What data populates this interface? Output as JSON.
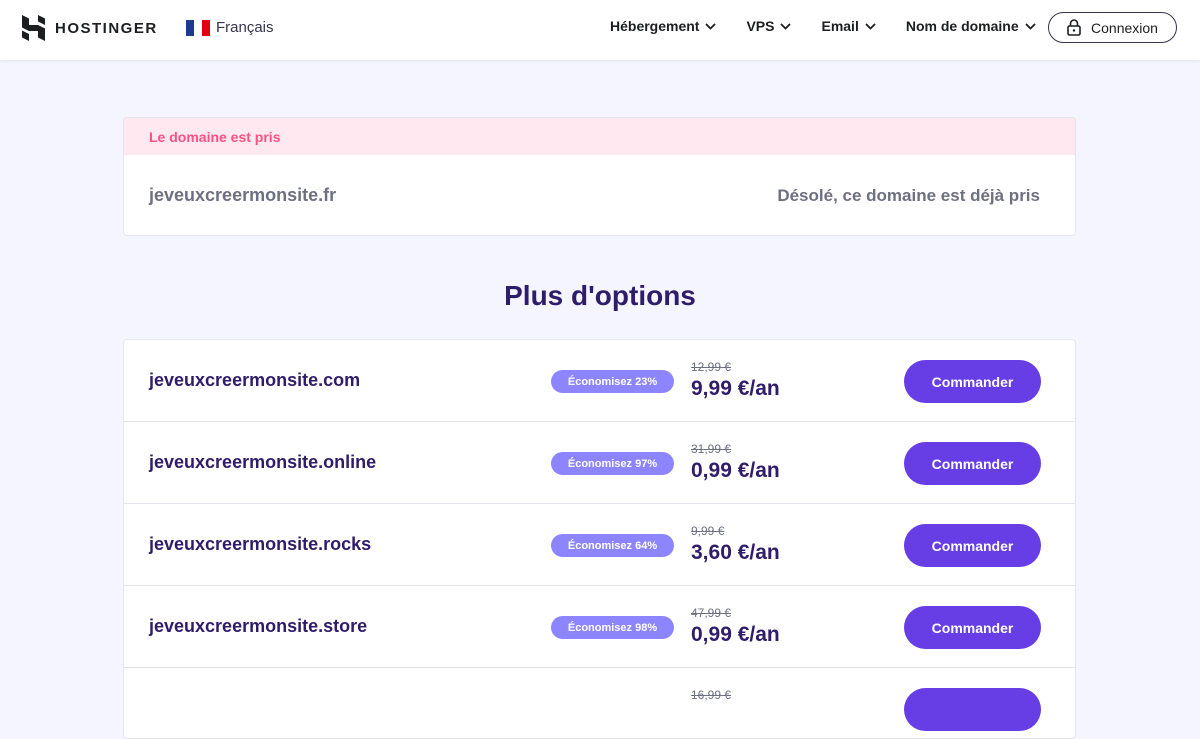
{
  "header": {
    "brand": "HOSTINGER",
    "language": "Français",
    "nav": [
      {
        "label": "Hébergement"
      },
      {
        "label": "VPS"
      },
      {
        "label": "Email"
      },
      {
        "label": "Nom de domaine"
      }
    ],
    "login_label": "Connexion"
  },
  "taken": {
    "title": "Le domaine est pris",
    "domain": "jeveuxcreermonsite.fr",
    "message": "Désolé, ce domaine est déjà pris"
  },
  "options_title": "Plus d'options",
  "options": [
    {
      "domain": "jeveuxcreermonsite.com",
      "badge": "Économisez 23%",
      "old_price": "12,99 €",
      "price": "9,99 €/an",
      "button": "Commander"
    },
    {
      "domain": "jeveuxcreermonsite.online",
      "badge": "Économisez 97%",
      "old_price": "31,99 €",
      "price": "0,99 €/an",
      "button": "Commander"
    },
    {
      "domain": "jeveuxcreermonsite.rocks",
      "badge": "Économisez 64%",
      "old_price": "9,99 €",
      "price": "3,60 €/an",
      "button": "Commander"
    },
    {
      "domain": "jeveuxcreermonsite.store",
      "badge": "Économisez 98%",
      "old_price": "47,99 €",
      "price": "0,99 €/an",
      "button": "Commander"
    },
    {
      "domain": "",
      "badge": "",
      "old_price": "16,99 €",
      "price": "",
      "button": ""
    }
  ],
  "colors": {
    "accent": "#673de6",
    "badge": "#8c85ff",
    "error": "#fc5185",
    "error_bg": "#ffe8ef",
    "heading": "#2f1c6a"
  },
  "icons": {
    "logo": "hostinger-logo-icon",
    "flag": "france-flag-icon",
    "chevron": "chevron-down-icon",
    "lock": "lock-icon"
  }
}
